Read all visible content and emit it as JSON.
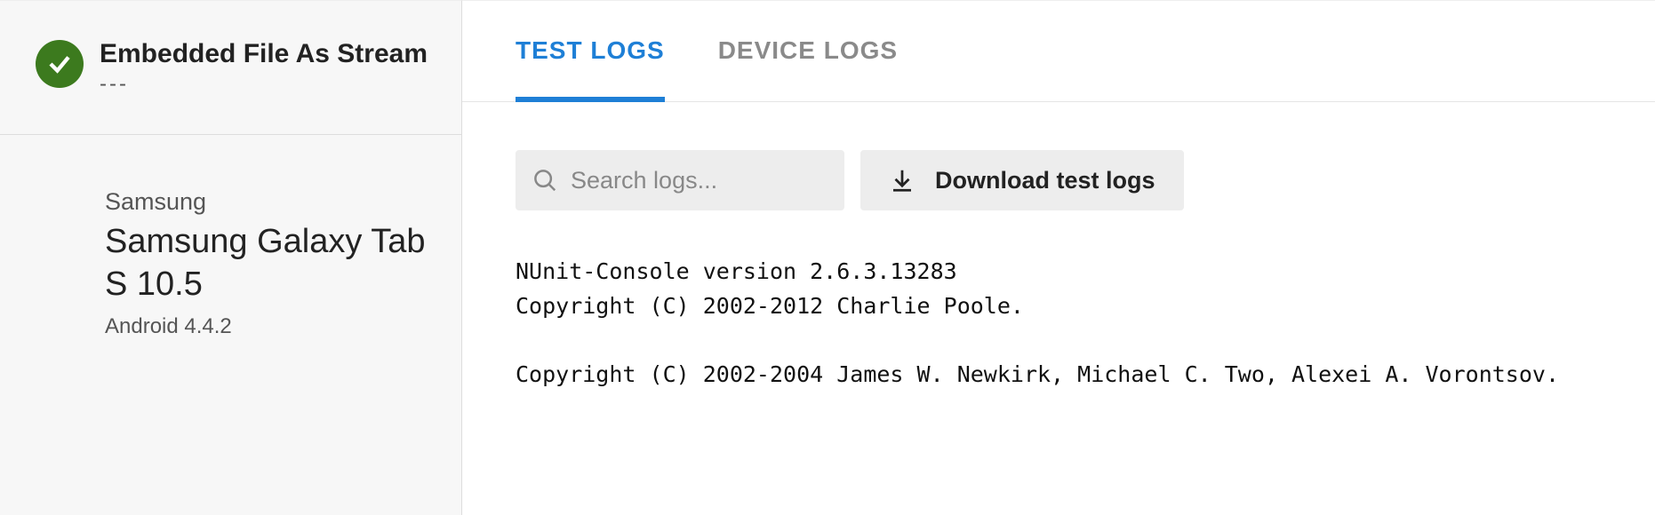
{
  "sidebar": {
    "test_title": "Embedded File As Stream",
    "test_subtitle": "---",
    "status": "passed",
    "device_manufacturer": "Samsung",
    "device_name": "Samsung Galaxy Tab S 10.5",
    "device_os": "Android 4.4.2"
  },
  "main": {
    "tabs": [
      {
        "label": "TEST LOGS",
        "active": true
      },
      {
        "label": "DEVICE LOGS",
        "active": false
      }
    ],
    "search": {
      "placeholder": "Search logs...",
      "value": ""
    },
    "download_label": "Download test logs",
    "log_lines": [
      "NUnit-Console version 2.6.3.13283",
      "Copyright (C) 2002-2012 Charlie Poole.",
      "",
      "Copyright (C) 2002-2004 James W. Newkirk, Michael C. Two, Alexei A. Vorontsov."
    ]
  }
}
